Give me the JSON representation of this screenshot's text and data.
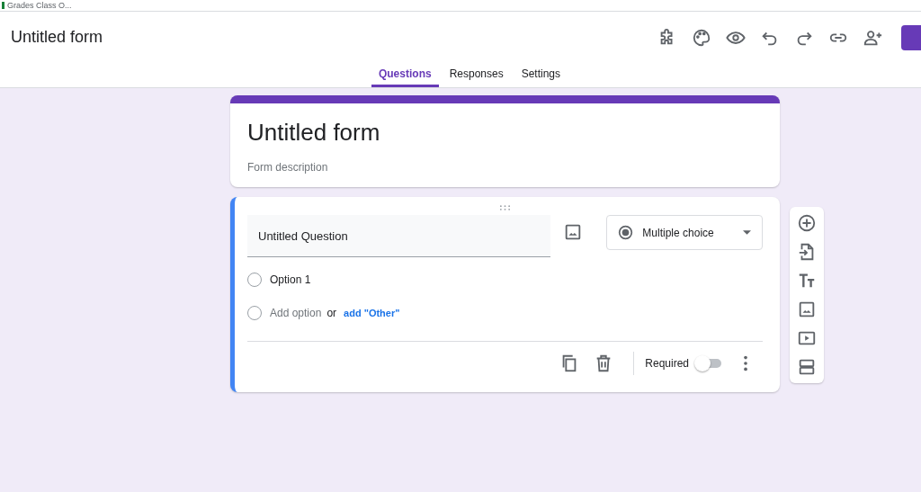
{
  "browser_tab": {
    "title": "Grades Class O..."
  },
  "header": {
    "title": "Untitled form"
  },
  "tabs": [
    {
      "label": "Questions",
      "selected": true
    },
    {
      "label": "Responses",
      "selected": false
    },
    {
      "label": "Settings",
      "selected": false
    }
  ],
  "form_header": {
    "title": "Untitled form",
    "description_placeholder": "Form description"
  },
  "question": {
    "title": "Untitled Question",
    "type": "Multiple choice",
    "options": [
      {
        "label": "Option 1",
        "selected": false
      }
    ],
    "add_option_selected": false,
    "add_option": "Add option",
    "or": "or",
    "add_other": "add \"Other\"",
    "required_label": "Required",
    "required": false
  }
}
